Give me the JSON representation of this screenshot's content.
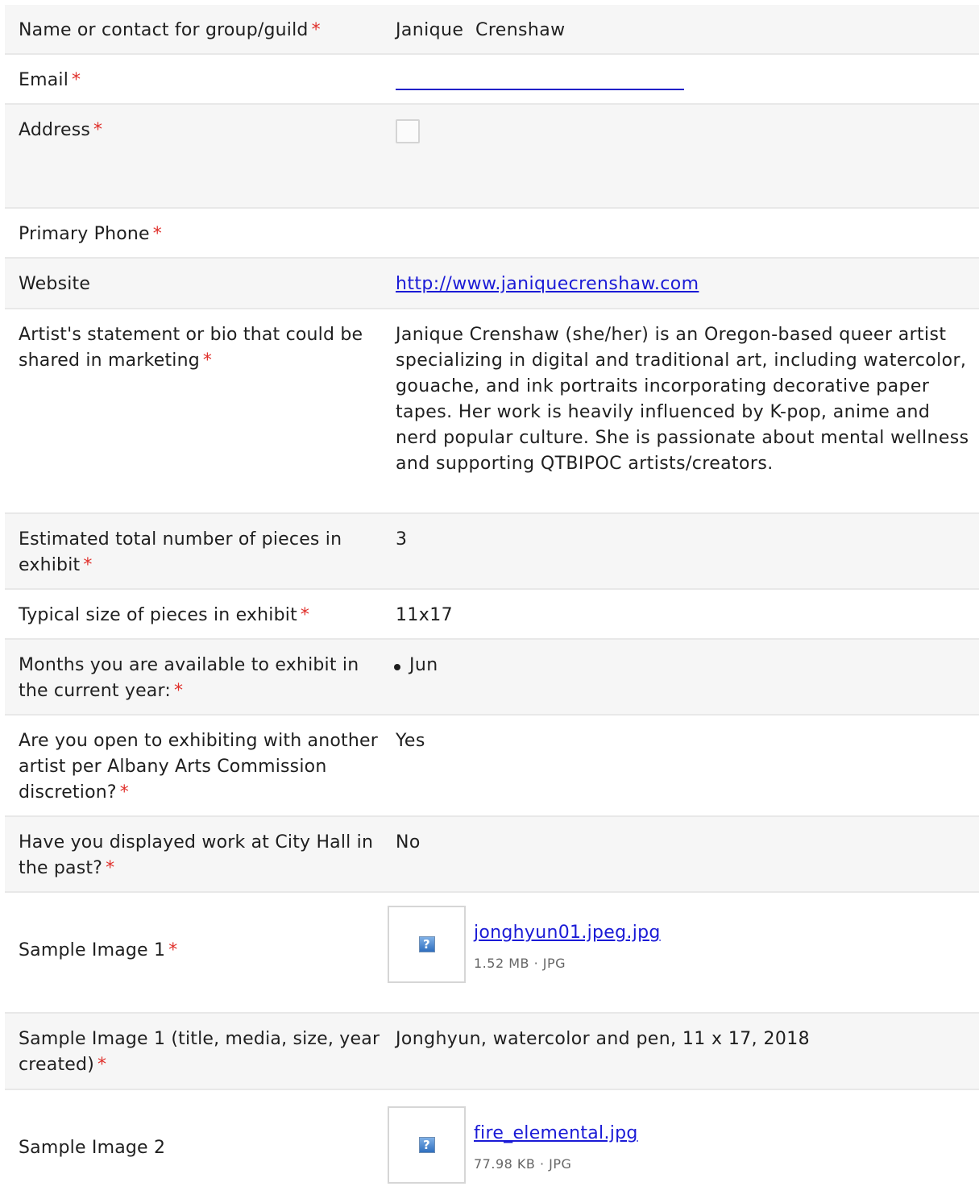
{
  "fields": [
    {
      "label": "Name or contact for group/guild",
      "value": "Janique  Crenshaw"
    },
    {
      "label": "Email"
    },
    {
      "label": "Address"
    },
    {
      "label": "Primary Phone"
    },
    {
      "label": "Website",
      "value": "http://www.janiquecrenshaw.com"
    },
    {
      "label": "Artist's statement or bio that could be shared in marketing",
      "value": "Janique Crenshaw (she/her) is an Oregon-based queer artist specializing in digital and traditional art, including watercolor, gouache, and ink portraits incorporating decorative paper tapes. Her work is heavily influenced by K-pop, anime and nerd popular culture. She is passionate about mental wellness and supporting QTBIPOC artists/creators."
    },
    {
      "label": "Estimated total number of pieces in exhibit",
      "value": "3"
    },
    {
      "label": "Typical size of pieces in exhibit",
      "value": "11x17"
    },
    {
      "label": "Months you are available to exhibit in the current year:",
      "items": [
        "Jun"
      ]
    },
    {
      "label": "Are you open to exhibiting with another artist per Albany Arts Commission discretion?",
      "value": "Yes"
    },
    {
      "label": "Have you displayed work at City Hall in the past?",
      "value": "No"
    },
    {
      "label": "Sample Image 1",
      "file": {
        "name": "jonghyun01.jpeg.jpg",
        "size": "1.52 MB",
        "type": "JPG"
      }
    },
    {
      "label": "Sample Image 1 (title, media, size, year created)",
      "value": "Jonghyun, watercolor and pen, 11 x 17, 2018"
    },
    {
      "label": "Sample Image 2",
      "file": {
        "name": "fire_elemental.jpg",
        "size": "77.98 KB",
        "type": "JPG"
      }
    }
  ],
  "required_marker": "*",
  "meta_separator": "·",
  "broken_image_glyph": "?",
  "icons": {
    "broken_image": "broken-image-icon",
    "bullet": "bullet-icon"
  },
  "colors": {
    "required": "#e0302b",
    "link": "#1a1ad6",
    "row_shade": "#f6f6f6",
    "divider": "#e8e8e8"
  }
}
